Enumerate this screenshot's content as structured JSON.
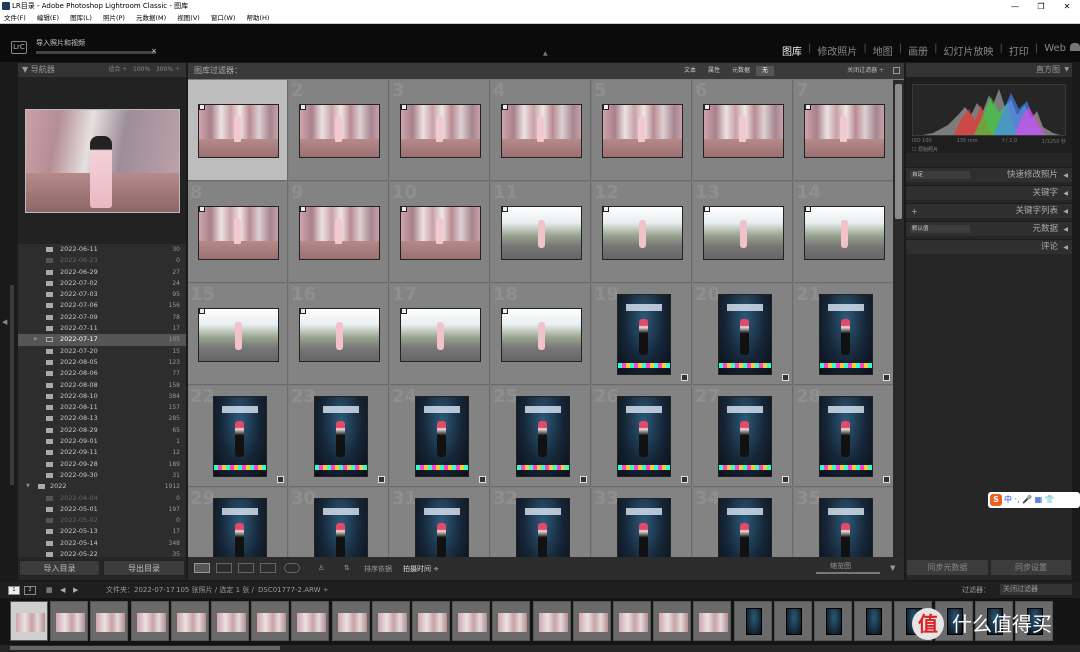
{
  "window": {
    "title": "LR目录 - Adobe Photoshop Lightroom Classic - 图库",
    "min": "—",
    "max": "❐",
    "close": "✕"
  },
  "menu": [
    "文件(F)",
    "编辑(E)",
    "图库(L)",
    "照片(P)",
    "元数据(M)",
    "视图(V)",
    "窗口(W)",
    "帮助(H)"
  ],
  "top": {
    "lrc": "LrC",
    "import_title": "导入照片和视频",
    "import_close": "×"
  },
  "modules": [
    "图库",
    "修改照片",
    "地图",
    "画册",
    "幻灯片放映",
    "打印",
    "Web"
  ],
  "navigator": {
    "title": "导航器",
    "fit": "适合",
    "p100": "100%",
    "p300": "300%"
  },
  "folders": [
    {
      "name": "2022-06-11",
      "count": "30",
      "state": "normal"
    },
    {
      "name": "2022-06-23",
      "count": "0",
      "state": "dim"
    },
    {
      "name": "2022-06-29",
      "count": "27",
      "state": "normal"
    },
    {
      "name": "2022-07-02",
      "count": "24",
      "state": "normal"
    },
    {
      "name": "2022-07-03",
      "count": "95",
      "state": "normal"
    },
    {
      "name": "2022-07-06",
      "count": "156",
      "state": "normal"
    },
    {
      "name": "2022-07-09",
      "count": "78",
      "state": "normal"
    },
    {
      "name": "2022-07-11",
      "count": "17",
      "state": "normal"
    },
    {
      "name": "2022-07-17",
      "count": "105",
      "state": "sel"
    },
    {
      "name": "2022-07-20",
      "count": "15",
      "state": "normal"
    },
    {
      "name": "2022-08-05",
      "count": "123",
      "state": "normal"
    },
    {
      "name": "2022-08-06",
      "count": "77",
      "state": "normal"
    },
    {
      "name": "2022-08-08",
      "count": "158",
      "state": "normal"
    },
    {
      "name": "2022-08-10",
      "count": "384",
      "state": "normal"
    },
    {
      "name": "2022-08-11",
      "count": "157",
      "state": "normal"
    },
    {
      "name": "2022-08-13",
      "count": "285",
      "state": "normal"
    },
    {
      "name": "2022-08-29",
      "count": "65",
      "state": "normal"
    },
    {
      "name": "2022-09-01",
      "count": "1",
      "state": "normal"
    },
    {
      "name": "2022-09-11",
      "count": "12",
      "state": "normal"
    },
    {
      "name": "2022-09-28",
      "count": "189",
      "state": "normal"
    },
    {
      "name": "2022-09-30",
      "count": "31",
      "state": "normal"
    },
    {
      "name": "2022",
      "count": "1912",
      "state": "top"
    },
    {
      "name": "2022-04-04",
      "count": "0",
      "state": "dim"
    },
    {
      "name": "2022-05-01",
      "count": "197",
      "state": "normal"
    },
    {
      "name": "2022-05-02",
      "count": "0",
      "state": "dim"
    },
    {
      "name": "2022-05-13",
      "count": "17",
      "state": "normal"
    },
    {
      "name": "2022-05-14",
      "count": "348",
      "state": "normal"
    },
    {
      "name": "2022-05-22",
      "count": "35",
      "state": "normal"
    }
  ],
  "left_buttons": {
    "import": "导入目录",
    "export": "导出目录"
  },
  "filter": {
    "title": "图库过滤器：",
    "tabs": [
      "文本",
      "属性",
      "元数据",
      "无"
    ],
    "close": "关闭过滤器 ÷"
  },
  "grid_numbers": [
    "",
    "2",
    "3",
    "4",
    "5",
    "6",
    "7",
    "8",
    "9",
    "10",
    "11",
    "12",
    "13",
    "14",
    "15",
    "16",
    "17",
    "18",
    "19",
    "20",
    "21",
    "22",
    "23",
    "24",
    "25",
    "26",
    "27",
    "28",
    "29",
    "30",
    "31",
    "32",
    "33",
    "34",
    "35"
  ],
  "toolbar": {
    "sort_label": "排序依据",
    "sort_value": "拍摄时间 ÷",
    "thumb_label": "缩览图"
  },
  "histogram": {
    "title": "直方图",
    "iso": "ISO 100",
    "focal": "135 mm",
    "aperture": "f / 2.0",
    "shutter": "1/1250 秒",
    "original": "原始照片"
  },
  "right_panels": {
    "quick_preset": "自定",
    "quick_title": "快速修改照片",
    "keywords": "关键字",
    "keyword_list": "关键字列表",
    "meta_preset": "默认值",
    "metadata": "元数据",
    "comments": "评论"
  },
  "right_buttons": {
    "sync_meta": "同步元数据",
    "sync_settings": "同步设置"
  },
  "filmstrip_bar": {
    "box1": "1",
    "box2": "2",
    "source": "文件夹：2022-07-17",
    "count": "105 张照片 / 选定 1 张 /",
    "file": "DSC01777-2.ARW ÷",
    "filter_label": "过滤器：",
    "filter_value": "关闭过滤器"
  },
  "watermark": {
    "logo": "值",
    "text": "什么值得买"
  },
  "ime": {
    "logo": "S",
    "text": "中 ·, 🎤 ▦ 👕"
  }
}
